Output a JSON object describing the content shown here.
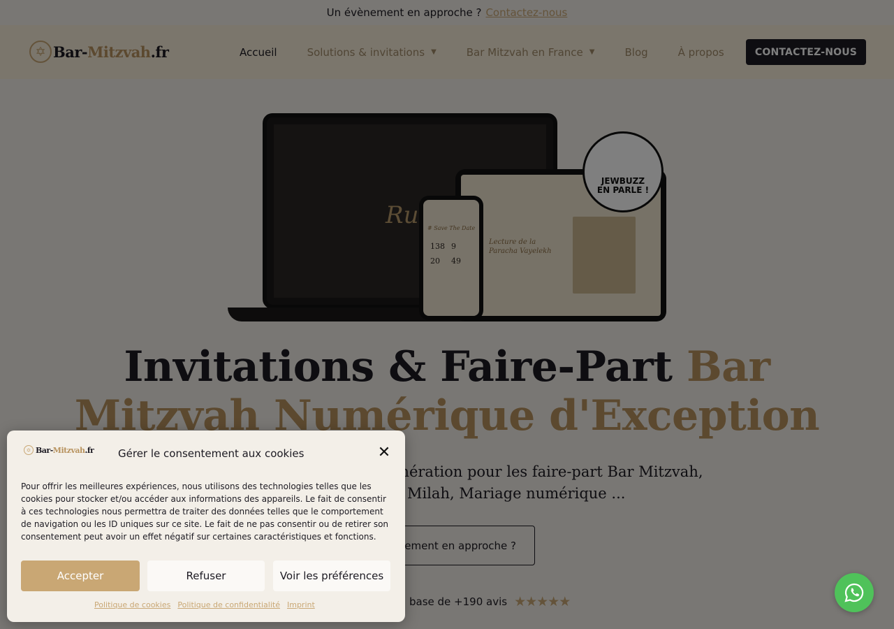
{
  "topbar": {
    "text": "Un évènement en approche ?",
    "link": "Contactez-nous"
  },
  "header": {
    "logo_main": "Bar-",
    "logo_gold": "Mitzvah",
    "logo_tld": ".fr",
    "nav": [
      {
        "label": "Accueil",
        "active": true
      },
      {
        "label": "Solutions & invitations",
        "dropdown": true
      },
      {
        "label": "Bar Mitzvah en France",
        "dropdown": true
      },
      {
        "label": "Blog"
      },
      {
        "label": "À propos"
      }
    ],
    "cta": "CONTACTEZ-NOUS"
  },
  "hero": {
    "badge_line1": "JEWBUZZ",
    "badge_line2": "EN PARLE !",
    "mock_laptop_script": "Rut",
    "mock_tablet_script": "Lecture de la Paracha Vayelekh",
    "mock_phone_script": "# Save The Date",
    "mock_phone_counts": [
      "138",
      "9",
      "20",
      "49"
    ],
    "headline_dark": "Invitations & Faire-Part ",
    "headline_gold": "Bar Mitzvah Numérique d'Exception",
    "sub_line1": "énération pour les faire-part Bar Mitzvah,",
    "sub_line2": "Milah, Mariage numérique ...",
    "outline_button": "ènement en approche ?",
    "reviews_text": "base de +190 avis",
    "stars": "★★★★★"
  },
  "cookie": {
    "logo_main": "Bar-",
    "logo_gold": "Mitzvah",
    "logo_tld": ".fr",
    "title": "Gérer le consentement aux cookies",
    "body": "Pour offrir les meilleures expériences, nous utilisons des technologies telles que les cookies pour stocker et/ou accéder aux informations des appareils. Le fait de consentir à ces technologies nous permettra de traiter des données telles que le comportement de navigation ou les ID uniques sur ce site. Le fait de ne pas consentir ou de retirer son consentement peut avoir un effet négatif sur certaines caractéristiques et fonctions.",
    "accept": "Accepter",
    "refuse": "Refuser",
    "prefs": "Voir les préférences",
    "links": [
      "Politique de cookies",
      "Politique de confidentialité",
      "Imprint"
    ]
  },
  "colors": {
    "gold": "#c9a774",
    "dark": "#1c1a22",
    "whatsapp": "#4fc25a"
  }
}
